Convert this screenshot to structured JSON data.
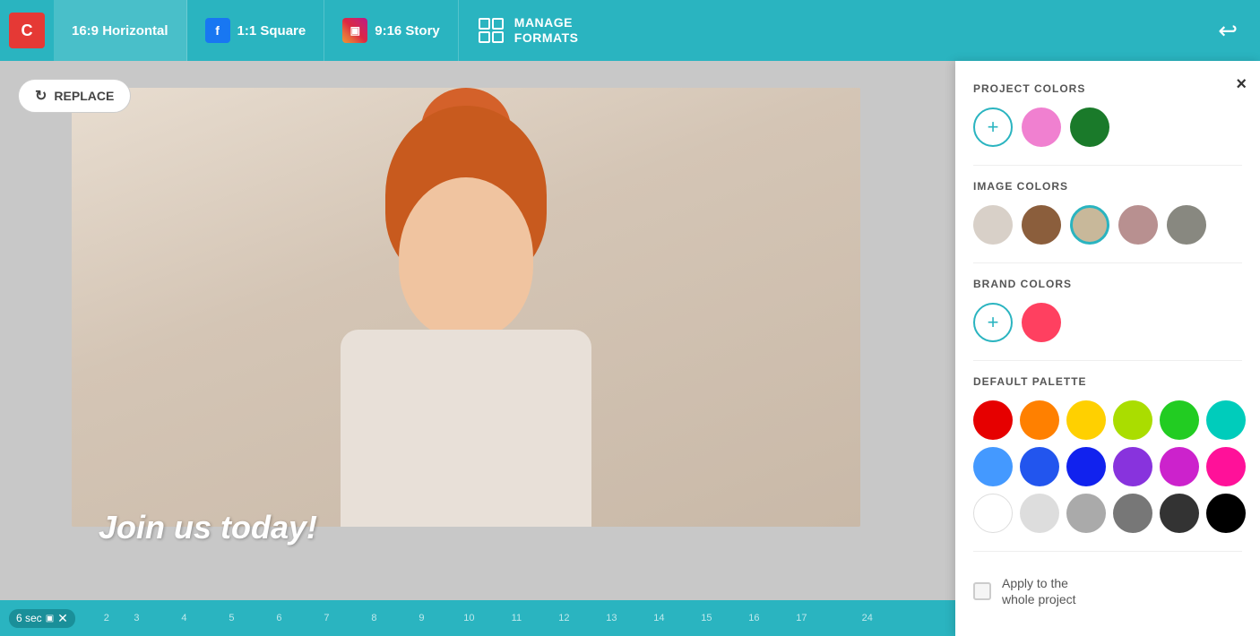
{
  "topbar": {
    "logo_label": "C",
    "tab_horizontal_label": "16:9 Horizontal",
    "tab_fb_label": "1:1 Square",
    "tab_fb_icon": "f",
    "tab_ig_label": "9:16 Story",
    "tab_ig_icon": "📷",
    "manage_formats_label": "MANAGE FORMATS",
    "undo_symbol": "↩"
  },
  "canvas": {
    "replace_btn_label": "REPLACE",
    "canvas_text": "Join us today!"
  },
  "timeline": {
    "time_label": "6 sec",
    "markers": [
      "2",
      "3",
      "4",
      "5",
      "6",
      "7",
      "8",
      "9",
      "10",
      "11",
      "12",
      "13",
      "14",
      "15",
      "16",
      "17",
      "",
      "",
      "",
      "",
      "",
      "",
      "24"
    ]
  },
  "color_panel": {
    "close_symbol": "×",
    "project_colors_title": "PROJECT COLORS",
    "add_color_symbol": "+",
    "project_colors": [
      {
        "color": "#f080d0",
        "selected": false
      },
      {
        "color": "#1a7a2a",
        "selected": false
      }
    ],
    "image_colors_title": "IMAGE COLORS",
    "image_colors": [
      {
        "color": "#d8d0c8",
        "selected": false
      },
      {
        "color": "#8b5e3c",
        "selected": false
      },
      {
        "color": "#c8b89a",
        "selected": true
      },
      {
        "color": "#b89090",
        "selected": false
      },
      {
        "color": "#888880",
        "selected": false
      }
    ],
    "brand_colors_title": "BRAND COLORS",
    "brand_colors": [
      {
        "color": "#ff4060",
        "selected": false
      }
    ],
    "default_palette_title": "DEFAULT PALETTE",
    "palette_colors": [
      "#e60000",
      "#ff8000",
      "#ffd000",
      "#aadd00",
      "#22cc22",
      "#00ccbb",
      "#4499ff",
      "#2255ee",
      "#1122ee",
      "#8833dd",
      "#cc22cc",
      "#ff1199",
      "#ffffff",
      "#dddddd",
      "#aaaaaa",
      "#777777",
      "#333333",
      "#000000"
    ],
    "apply_label_line1": "Apply to the",
    "apply_label_line2": "whole project"
  }
}
